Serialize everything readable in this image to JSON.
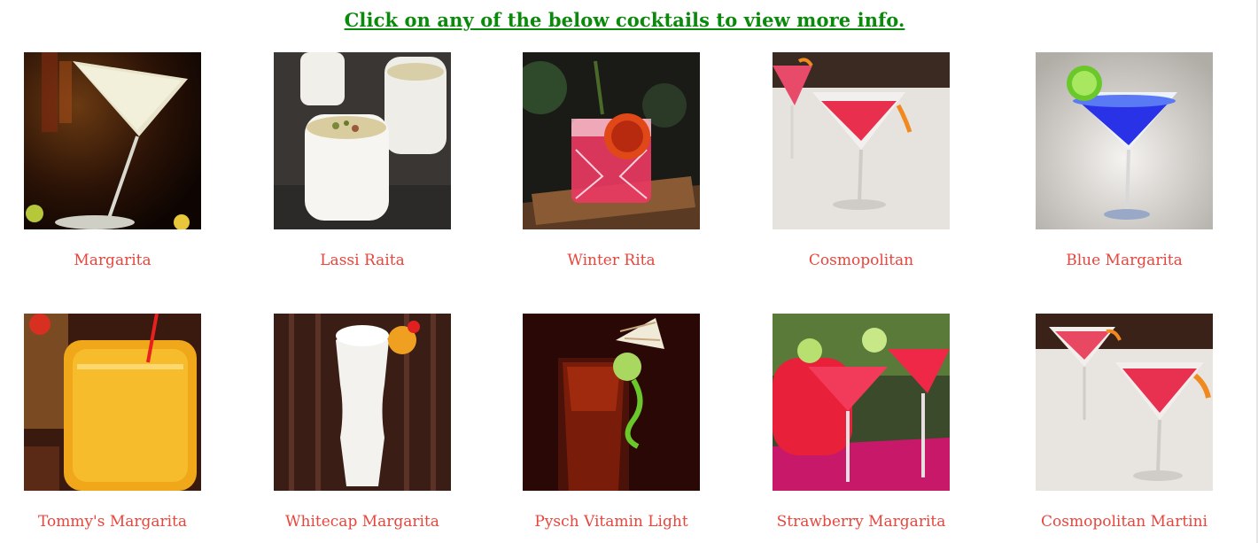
{
  "header": {
    "instruction_link": "Click on any of the below cocktails to view more info."
  },
  "cocktails": [
    {
      "name": "Margarita",
      "icon": "margarita-photo"
    },
    {
      "name": "Lassi Raita",
      "icon": "lassi-photo"
    },
    {
      "name": "Winter Rita",
      "icon": "winter-rita-photo"
    },
    {
      "name": "Cosmopolitan",
      "icon": "cosmopolitan-photo"
    },
    {
      "name": "Blue Margarita",
      "icon": "blue-margarita-photo"
    },
    {
      "name": "Tommy's Margarita",
      "icon": "tommys-margarita-photo"
    },
    {
      "name": "Whitecap Margarita",
      "icon": "whitecap-margarita-photo"
    },
    {
      "name": "Pysch Vitamin Light",
      "icon": "pysch-vitamin-light-photo"
    },
    {
      "name": "Strawberry Margarita",
      "icon": "strawberry-margarita-photo"
    },
    {
      "name": "Cosmopolitan Martini",
      "icon": "cosmopolitan-martini-photo"
    }
  ],
  "colors": {
    "header_link": "#0a8a0a",
    "cocktail_label": "#e8453c",
    "background": "#ffffff"
  }
}
